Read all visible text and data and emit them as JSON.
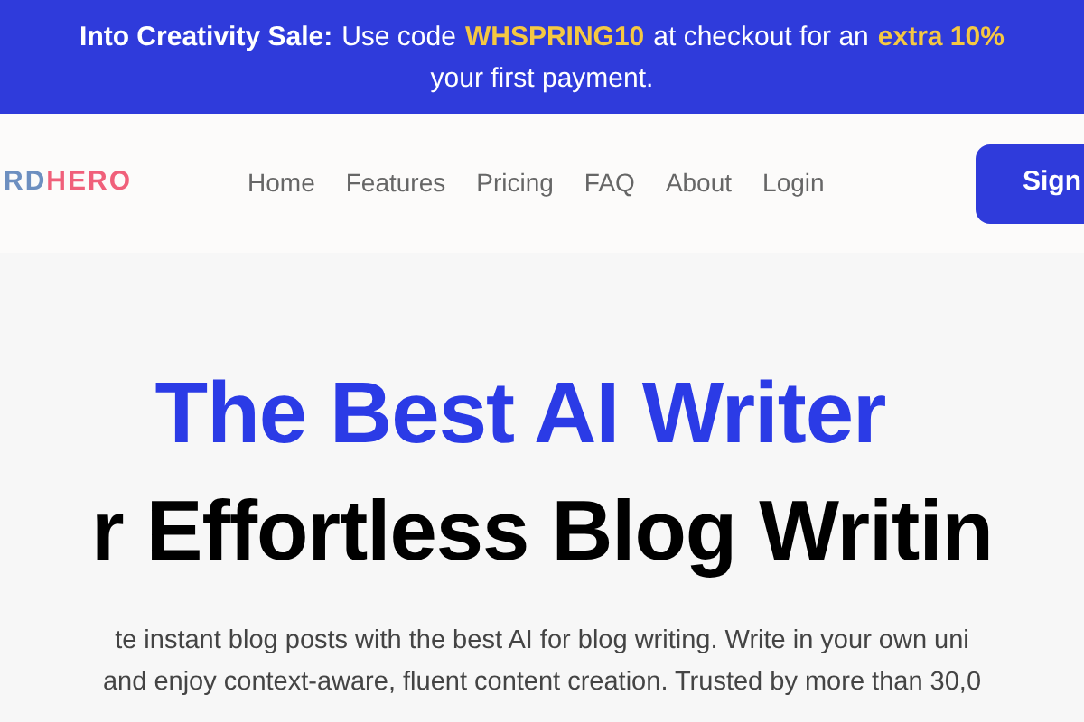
{
  "banner": {
    "lines": [
      [
        {
          "kind": "bold",
          "text": "Into Creativity Sale:"
        },
        {
          "kind": "plain",
          "text": "Use code"
        },
        {
          "kind": "highlight",
          "text": "WHSPRING10"
        },
        {
          "kind": "plain",
          "text": "at checkout for an"
        },
        {
          "kind": "highlight",
          "text": "extra 10%"
        }
      ],
      [
        {
          "kind": "plain",
          "text": "your first payment."
        }
      ]
    ]
  },
  "nav": {
    "logo": [
      {
        "kind": "muted",
        "text": "RD"
      },
      {
        "kind": "accent",
        "text": "HERO"
      }
    ],
    "links": [
      "Home",
      "Features",
      "Pricing",
      "FAQ",
      "About",
      "Login"
    ],
    "cta": "Sign"
  },
  "hero": {
    "title_lines": [
      "The Best AI Writer",
      "r Effortless Blog Writin"
    ],
    "description_lines": [
      "te instant blog posts with the best AI for blog writing. Write in your own uni",
      "and enjoy context-aware, fluent content creation. Trusted by more than 30,0"
    ]
  }
}
